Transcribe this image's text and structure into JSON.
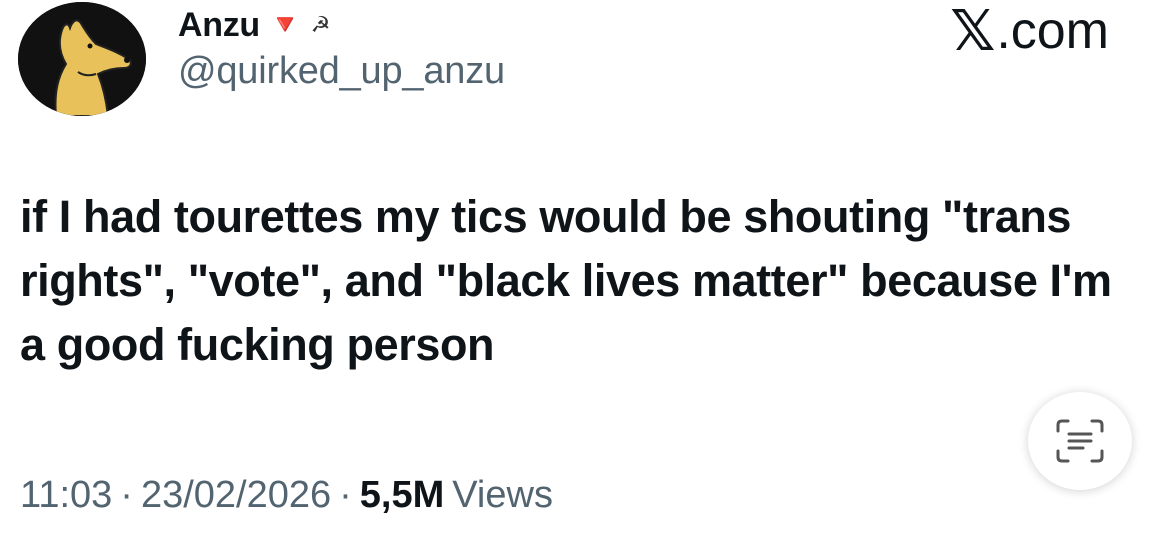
{
  "post": {
    "author": {
      "display_name": "Anzu",
      "badges": [
        {
          "icon": "red-down-triangle-icon",
          "glyph": "🔻"
        },
        {
          "icon": "hammer-sickle-icon",
          "glyph": "☭"
        }
      ],
      "handle": "@quirked_up_anzu"
    },
    "site": {
      "logo_mark": "𝕏",
      "logo_text": ".com"
    },
    "text": "if I had tourettes my tics would be shouting \"trans rights\", \"vote\", and \"black lives matter\" because I'm a good fucking person",
    "meta": {
      "time": "11:03",
      "separator": "·",
      "date": "23/02/2026",
      "views_count": "5,5M",
      "views_label": "Views"
    }
  },
  "colors": {
    "text": "#0f1419",
    "secondary": "#536471",
    "avatar_bg": "#111111",
    "avatar_figure": "#e9c15a"
  }
}
